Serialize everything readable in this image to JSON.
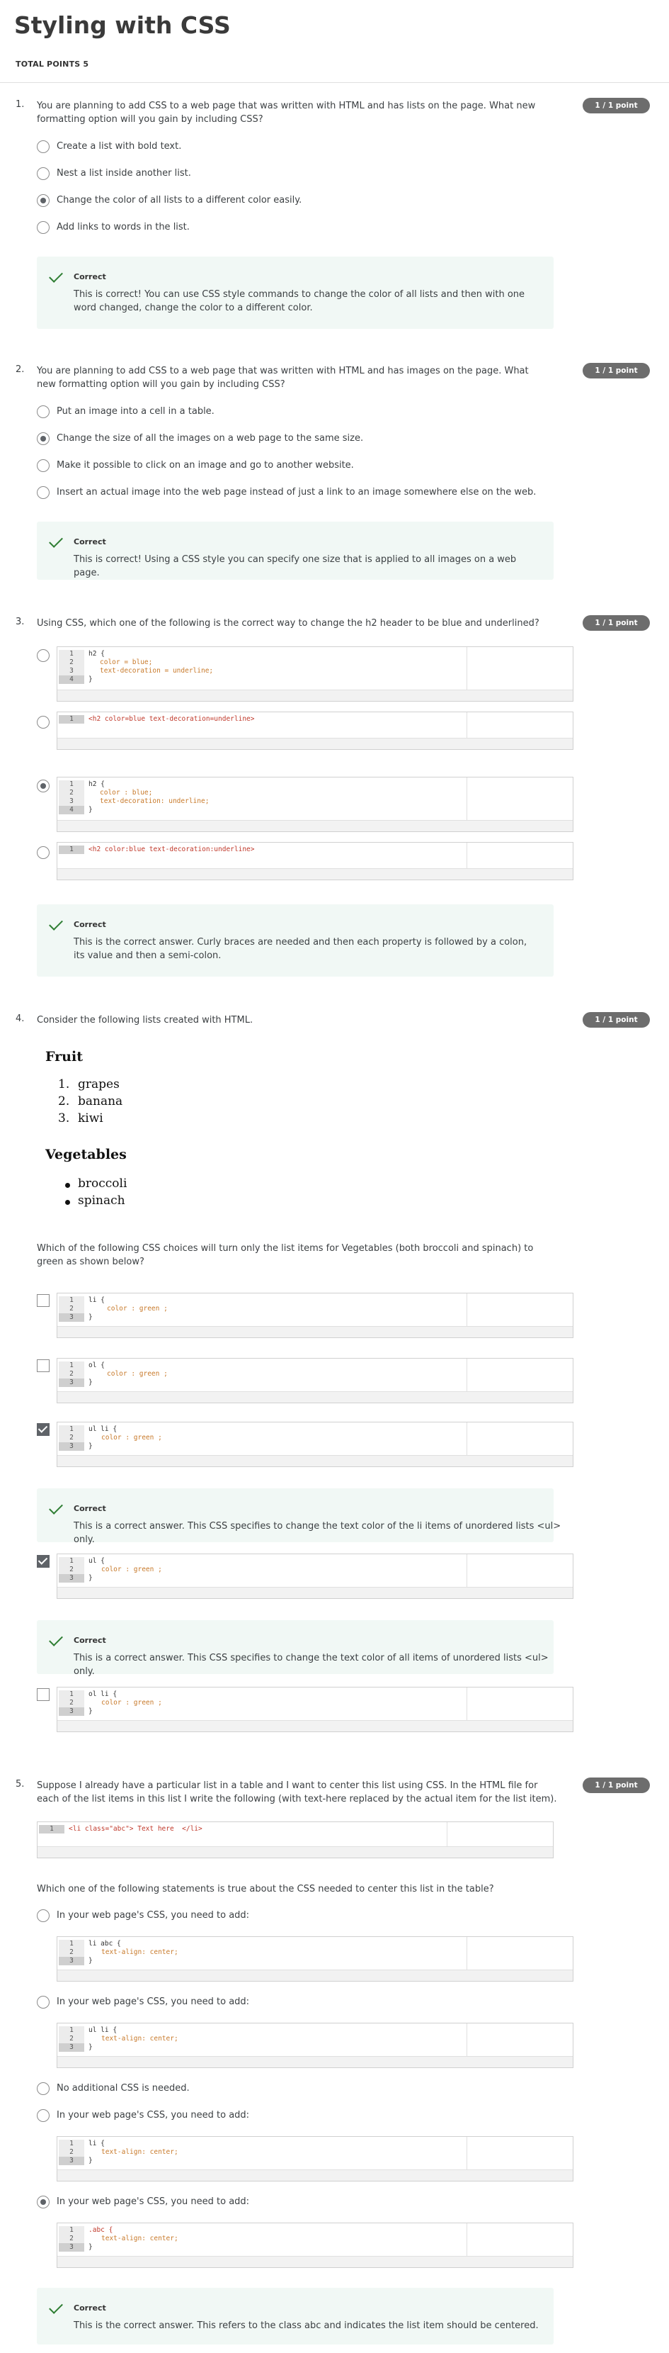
{
  "page": {
    "title": "Styling with CSS",
    "total_points": "TOTAL POINTS 5"
  },
  "q1": {
    "num": "1.",
    "text": "You are planning to add CSS to a web page that was written with HTML and has lists on the page. What new formatting option will you gain by including CSS?",
    "points": "1 / 1 point",
    "options": [
      "Create a list with bold text.",
      "Nest a list inside another list.",
      "Change the color of all lists to a different color easily.",
      "Add links to words in the list."
    ],
    "feedback_title": "Correct",
    "feedback_text": "This is correct! You can use CSS style commands to change the color of all lists and then with one word changed, change the color to a different color."
  },
  "q2": {
    "num": "2.",
    "text": "You are planning to add CSS to a web page that was written with HTML and has images on the page. What new formatting option will you gain by including CSS?",
    "points": "1 / 1 point",
    "options": [
      "Put an image into a cell in a table.",
      "Change the size of all the images on a web page to the same size.",
      "Make it possible to click on an image and go to another website.",
      "Insert an actual image into the web page instead of just a link to an image somewhere else on the web."
    ],
    "feedback_title": "Correct",
    "feedback_text": "This is correct! Using a CSS style you can specify one size that is applied to all images on a web page."
  },
  "q3": {
    "num": "3.",
    "text": "Using CSS, which one of the following is the correct way to change the h2 header to be blue and underlined?",
    "points": "1 / 1 point",
    "code_a": [
      "h2 {",
      "color = blue;",
      "text-decoration = underline;",
      "}"
    ],
    "code_b": [
      "<h2 color=blue text-decoration=underline>"
    ],
    "code_c": [
      "h2 {",
      "color : blue;",
      "text-decoration: underline;",
      "}"
    ],
    "code_d": [
      "<h2 color:blue text-decoration:underline>"
    ],
    "line_nums": [
      "1",
      "2",
      "3",
      "4"
    ],
    "feedback_title": "Correct",
    "feedback_text": "This is the correct answer. Curly braces are needed and then each property is followed by a colon, its value and then a semi-colon."
  },
  "q4": {
    "num": "4.",
    "text": "Consider the following lists created with HTML.",
    "points": "1 / 1 point",
    "fruit_heading": "Fruit",
    "fruit_items": [
      "grapes",
      "banana",
      "kiwi"
    ],
    "fruit_markers": [
      "1.",
      "2.",
      "3."
    ],
    "veg_heading": "Vegetables",
    "veg_items": [
      "broccoli",
      "spinach"
    ],
    "question": "Which of the following CSS choices will turn only the list items for Vegetables (both broccoli and spinach) to green as shown below?",
    "code_a": [
      "li {",
      "color : green ;",
      "}"
    ],
    "code_b": [
      "ol {",
      "color : green ;",
      "}"
    ],
    "code_c": [
      "ul li {",
      "color : green ;",
      "}"
    ],
    "code_d": [
      "ul {",
      "color : green ;",
      "}"
    ],
    "code_e": [
      "ol li {",
      "color : green ;",
      "}"
    ],
    "line_nums": [
      "1",
      "2",
      "3"
    ],
    "feedback_title": "Correct",
    "feedback_c": "This is a correct answer. This CSS specifies to change the text color of the li items of unordered lists <ul> only.",
    "feedback_d": "This is a correct answer. This CSS specifies to change the text color of all items of unordered lists <ul> only."
  },
  "q5": {
    "num": "5.",
    "text": "Suppose I already have a particular list in a table and I want to center this list using CSS. In the HTML file for each of the list items in this list I write the following (with text-here replaced by the actual item for the list item).",
    "points": "1 / 1 point",
    "html_code": "<li class=\"abc\"> Text here  </li>",
    "question": "Which one of the following statements is true about the CSS needed to center this list in the table?",
    "opt_label": "In your web page's CSS, you need to add:",
    "opt_none": "No additional CSS is needed.",
    "code_a": [
      "li abc {",
      "text-align: center;",
      "}"
    ],
    "code_b": [
      "ul li {",
      "text-align: center;",
      "}"
    ],
    "code_c": [
      "li {",
      "text-align: center;",
      "}"
    ],
    "code_d": [
      ".abc {",
      "text-align: center;",
      "}"
    ],
    "line_nums": [
      "1",
      "2",
      "3"
    ],
    "feedback_title": "Correct",
    "feedback_text": "This is the correct answer. This refers to the class abc and indicates the list item should be centered."
  }
}
